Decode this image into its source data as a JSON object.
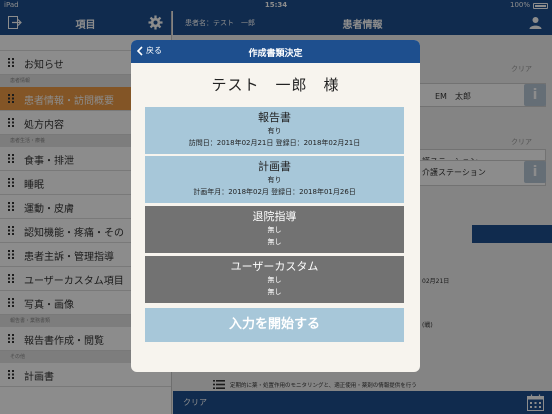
{
  "status_bar": {
    "device": "iPad",
    "time": "15:34",
    "battery": "100%"
  },
  "sidebar": {
    "title": "項目",
    "sections": [
      {
        "items": [
          {
            "label": "お知らせ",
            "active": false
          }
        ]
      },
      {
        "heading": "患者情報",
        "items": [
          {
            "label": "患者情報・訪問概要",
            "active": true
          },
          {
            "label": "処方内容",
            "active": false
          }
        ]
      },
      {
        "heading": "患者生活・療養",
        "items": [
          {
            "label": "食事・排泄",
            "active": false
          },
          {
            "label": "睡眠",
            "active": false
          },
          {
            "label": "運動・皮膚",
            "active": false
          },
          {
            "label": "認知機能・疼痛・その",
            "active": false
          },
          {
            "label": "患者主訴・管理指導",
            "active": false
          },
          {
            "label": "ユーザーカスタム項目",
            "active": false
          },
          {
            "label": "写真・画像",
            "active": false
          }
        ]
      },
      {
        "heading": "報告書・業務書類",
        "items": [
          {
            "label": "報告書作成・閲覧",
            "active": false
          }
        ]
      },
      {
        "heading": "その他",
        "items": [
          {
            "label": "計画書",
            "active": false
          }
        ]
      }
    ]
  },
  "main_header": {
    "patient_label": "患者名：テスト　一郎",
    "title": "患者情報"
  },
  "background": {
    "clear_top": "クリア",
    "name_value": "EM　太郎",
    "clear_mid": "クリア",
    "station_1": "護ステーション",
    "station_2": "介護ステーション",
    "date_value": "02月21日",
    "paren_value": "(戦)",
    "footnote": "定期的に薬・処置作用のモニタリングと、適正使用・薬剤の情報提供を行う"
  },
  "footer": {
    "clear_label": "クリア"
  },
  "modal": {
    "back_label": "戻る",
    "title": "作成書類決定",
    "patient": "テスト　一郎　様",
    "documents": [
      {
        "name": "報告書",
        "status": "有り",
        "date_line": "訪問日：2018年02月21日 登録日：2018年02月21日",
        "enabled": true
      },
      {
        "name": "計画書",
        "status": "有り",
        "date_line": "計画年月：2018年02月 登録日：2018年01月26日",
        "enabled": true
      },
      {
        "name": "退院指導",
        "status": "無し",
        "date_line": "無し",
        "enabled": false
      },
      {
        "name": "ユーザーカスタム",
        "status": "無し",
        "date_line": "無し",
        "enabled": false
      }
    ],
    "start_label": "入力を開始する"
  },
  "colors": {
    "primary": "#1e4f8e",
    "accent_active": "#ef9b45",
    "doc_enabled": "#a7c7d9",
    "doc_disabled": "#727272"
  },
  "icons": [
    "exit-icon",
    "gear-icon",
    "user-icon",
    "info-icon",
    "calendar-icon",
    "back-chevron-icon",
    "grip-icon",
    "list-icon"
  ]
}
